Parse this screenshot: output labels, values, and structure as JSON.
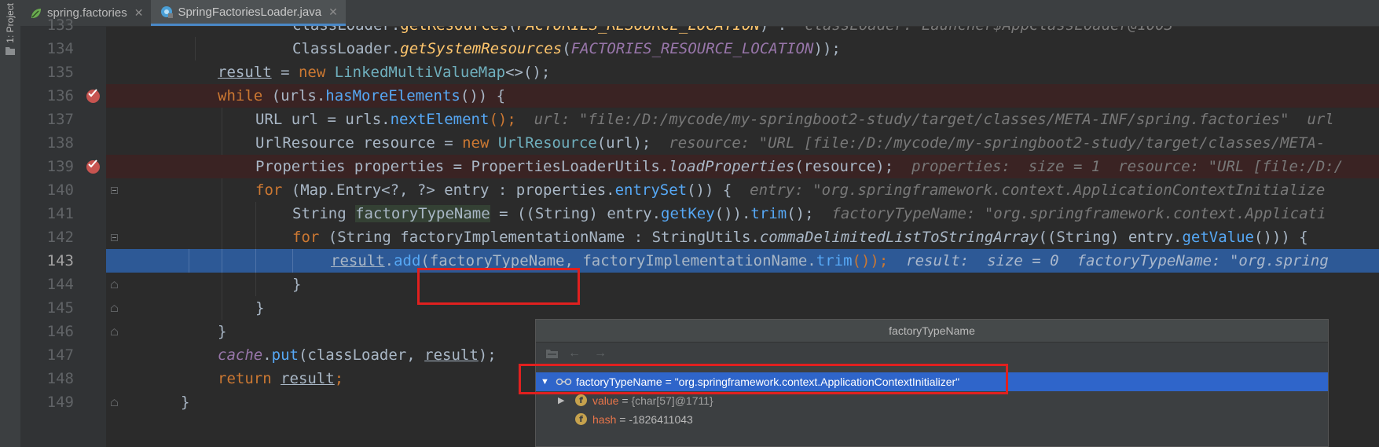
{
  "sidebar": {
    "project_label": "1: Project"
  },
  "tabs": [
    {
      "label": "spring.factories",
      "close": "✕"
    },
    {
      "label": "SpringFactoriesLoader.java",
      "close": "✕"
    }
  ],
  "editor": {
    "line_numbers": [
      "133",
      "134",
      "135",
      "136",
      "137",
      "138",
      "139",
      "140",
      "141",
      "142",
      "143",
      "144",
      "145",
      "146",
      "147",
      "148",
      "149"
    ],
    "current_line": "143",
    "lines": {
      "l133": {
        "a": "classLoader.",
        "b": "getResources",
        "c": "(",
        "d": "FACTORIES_RESOURCE_LOCATION",
        "e": ") :",
        "ann": "  classLoader: Launcher$AppClassLoader@1003"
      },
      "l134": {
        "a": "ClassLoader.",
        "b": "getSystemResources",
        "c": "(",
        "d": "FACTORIES_RESOURCE_LOCATION",
        "e": "));"
      },
      "l135": {
        "a": "result",
        "b": " = ",
        "c": "new",
        "d": " ",
        "e": "LinkedMultiValueMap",
        "f": "<>();"
      },
      "l136": {
        "a": "while",
        "b": " (urls.",
        "c": "hasMoreElements",
        "d": "()) {"
      },
      "l137": {
        "a": "URL url = urls.",
        "b": "nextElement",
        "c": "();",
        "ann": "  url: \"file:/D:/mycode/my-springboot2-study/target/classes/META-INF/spring.factories\"  url"
      },
      "l138": {
        "a": "UrlResource resource = ",
        "b": "new",
        "c": " ",
        "d": "UrlResource",
        "e": "(url);",
        "ann": "  resource: \"URL [file:/D:/mycode/my-springboot2-study/target/classes/META-"
      },
      "l139": {
        "a": "Properties properties = PropertiesLoaderUtils.",
        "b": "loadProperties",
        "c": "(resource);",
        "ann": "  properties:  size = 1  resource: \"URL [file:/D:/"
      },
      "l140": {
        "a": "for",
        "b": " (Map.Entry<?, ?> entry : properties.",
        "c": "entrySet",
        "d": "()) {",
        "ann": "  entry: \"org.springframework.context.ApplicationContextInitialize"
      },
      "l141": {
        "a": "String ",
        "b": "factoryTypeName",
        "c": " = ((String) entry.",
        "d": "getKey",
        "e": "()).",
        "f": "trim",
        "g": "();",
        "ann": "  factoryTypeName: \"org.springframework.context.Applicati"
      },
      "l142": {
        "a": "for",
        "b": " (String factoryImplementationName : StringUtils.",
        "c": "commaDelimitedListToStringArray",
        "d": "((String) entry.",
        "e": "getValue",
        "f": "())) {"
      },
      "l143": {
        "a": "result",
        "b": ".",
        "c": "add",
        "d": "(factoryTypeName",
        "e": ", factoryImplementationName.",
        "f": "trim",
        "g": "());",
        "ann": "  result:  size = 0  factoryTypeName: \"org.spring"
      },
      "l144": {
        "a": "}"
      },
      "l145": {
        "a": "}"
      },
      "l146": {
        "a": "}"
      },
      "l147": {
        "a": "cache",
        "b": ".",
        "c": "put",
        "d": "(classLoader, ",
        "e": "result",
        "f": ");"
      },
      "l148": {
        "a": "return",
        "b": " ",
        "c": "result",
        "d": ";"
      },
      "l149": {
        "a": "}"
      }
    }
  },
  "popup": {
    "title": "factoryTypeName",
    "tool_icons": [
      "folder-icon",
      "back-arrow-icon",
      "forward-arrow-icon"
    ],
    "back_glyph": "←",
    "forward_glyph": "→",
    "root": {
      "toggle": "▼",
      "name": "factoryTypeName",
      "eq": " = ",
      "value": "\"org.springframework.context.ApplicationContextInitializer\""
    },
    "children": [
      {
        "toggle": "▶",
        "badge": "f",
        "name": "value",
        "eq": " = ",
        "value": "{char[57]@1711}"
      },
      {
        "toggle": "",
        "badge": "f",
        "name": "hash",
        "eq": " = ",
        "value": "-1826411043"
      }
    ]
  },
  "colors": {
    "editor_bg": "#2b2b2b",
    "gutter_bg": "#313335",
    "keyword": "#cc7832",
    "method": "#ffc66d",
    "field": "#9876aa",
    "exec_line": "#2d5996",
    "breakpoint": "#c75450",
    "highlight_box": "#e0201f",
    "popup_selection": "#2f65ca"
  }
}
